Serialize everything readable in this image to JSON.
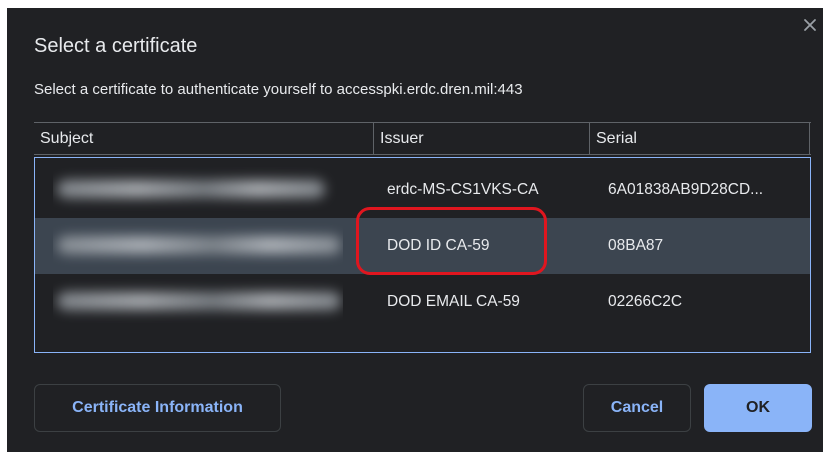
{
  "dialog": {
    "title": "Select a certificate",
    "subtitle": "Select a certificate to authenticate yourself to accesspki.erdc.dren.mil:443"
  },
  "table": {
    "columns": [
      "Subject",
      "Issuer",
      "Serial"
    ],
    "rows": [
      {
        "subject": "",
        "issuer": "erdc-MS-CS1VKS-CA",
        "serial": "6A01838AB9D28CD...",
        "selected": false
      },
      {
        "subject": "",
        "issuer": "DOD ID CA-59",
        "serial": "08BA87",
        "selected": true
      },
      {
        "subject": "",
        "issuer": "DOD EMAIL CA-59",
        "serial": "02266C2C",
        "selected": false
      }
    ]
  },
  "buttons": {
    "info": "Certificate Information",
    "cancel": "Cancel",
    "ok": "OK"
  },
  "icons": {
    "close": "close-icon"
  },
  "colors": {
    "background": "#202124",
    "accent": "#8ab4f8",
    "selected_row": "#3c4550",
    "annotation": "#e0161f"
  }
}
